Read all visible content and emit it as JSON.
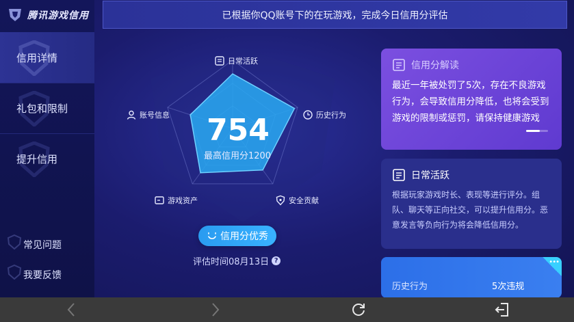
{
  "app": {
    "title": "腾讯游戏信用"
  },
  "sidebar": {
    "items": [
      {
        "label": "信用详情",
        "active": true
      },
      {
        "label": "礼包和限制",
        "active": false
      },
      {
        "label": "提升信用",
        "active": false
      }
    ],
    "bottom_items": [
      {
        "label": "常见问题"
      },
      {
        "label": "我要反馈"
      }
    ]
  },
  "banner": {
    "text": "已根据你QQ账号下的在玩游戏，完成今日信用分评估"
  },
  "radar": {
    "score": "754",
    "score_subtitle": "最高信用分1200",
    "axes": [
      {
        "label": "日常活跃",
        "icon": "document-icon",
        "value": 0.8
      },
      {
        "label": "历史行为",
        "icon": "clock-icon",
        "value": 0.95
      },
      {
        "label": "安全贡献",
        "icon": "shield-icon",
        "value": 0.75
      },
      {
        "label": "游戏资产",
        "icon": "wallet-icon",
        "value": 0.8
      },
      {
        "label": "账号信息",
        "icon": "user-icon",
        "value": 0.65
      }
    ]
  },
  "grade_button": {
    "label": "信用分优秀",
    "icon": "smile-icon"
  },
  "eval_time": {
    "text": "评估时间08月13日",
    "help_icon": "question-icon"
  },
  "cards": {
    "interpretation": {
      "title": "信用分解读",
      "icon": "document-icon",
      "body": "最近一年被处罚了5次，存在不良游戏行为，会导致信用分降低，也将会受到游戏的限制或惩罚，请保持健康游戏"
    },
    "daily_activity": {
      "title": "日常活跃",
      "icon": "document-icon",
      "body": "根据玩家游戏时长、表现等进行评分。组队、聊天等正向社交，可以提升信用分。恶意发言等负向行为将会降低信用分。"
    },
    "history": {
      "key": "历史行为",
      "value": "5次违规",
      "more_icon": "more-icon"
    }
  },
  "bottom_bar": {
    "icons": [
      "back-icon",
      "forward-icon",
      "refresh-icon",
      "exit-icon"
    ]
  },
  "colors": {
    "bg": "#1b1c6e",
    "radar_fill": "#29a9f2",
    "card1": "#6a45d8",
    "card2": "#2a2f8c",
    "card3": "#2c6fe8",
    "button": "#2a9bf0"
  }
}
